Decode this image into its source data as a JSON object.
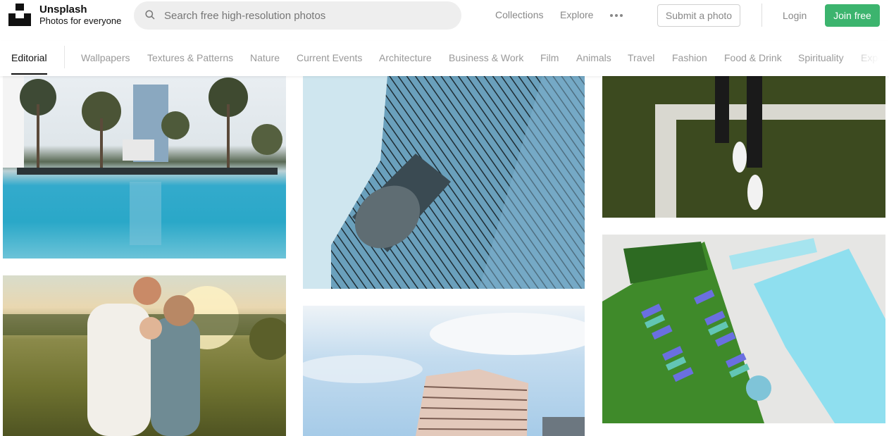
{
  "header": {
    "brand_name": "Unsplash",
    "brand_tagline": "Photos for everyone",
    "search_placeholder": "Search free high-resolution photos",
    "nav": [
      "Collections",
      "Explore"
    ],
    "more_label": "more-options",
    "submit_label": "Submit a photo",
    "login_label": "Login",
    "join_label": "Join free",
    "accent_color": "#3cb46e"
  },
  "categories": {
    "active": "Editorial",
    "items": [
      "Wallpapers",
      "Textures & Patterns",
      "Nature",
      "Current Events",
      "Architecture",
      "Business & Work",
      "Film",
      "Animals",
      "Travel",
      "Fashion",
      "Food & Drink",
      "Spirituality",
      "Experimental"
    ]
  },
  "photos": [
    {
      "subject": "pool with palm trees"
    },
    {
      "subject": "family in field at sunset"
    },
    {
      "subject": "glass skyscraper"
    },
    {
      "subject": "building against sky"
    },
    {
      "subject": "person on grass court"
    },
    {
      "subject": "aerial pool with lounge chairs"
    }
  ]
}
